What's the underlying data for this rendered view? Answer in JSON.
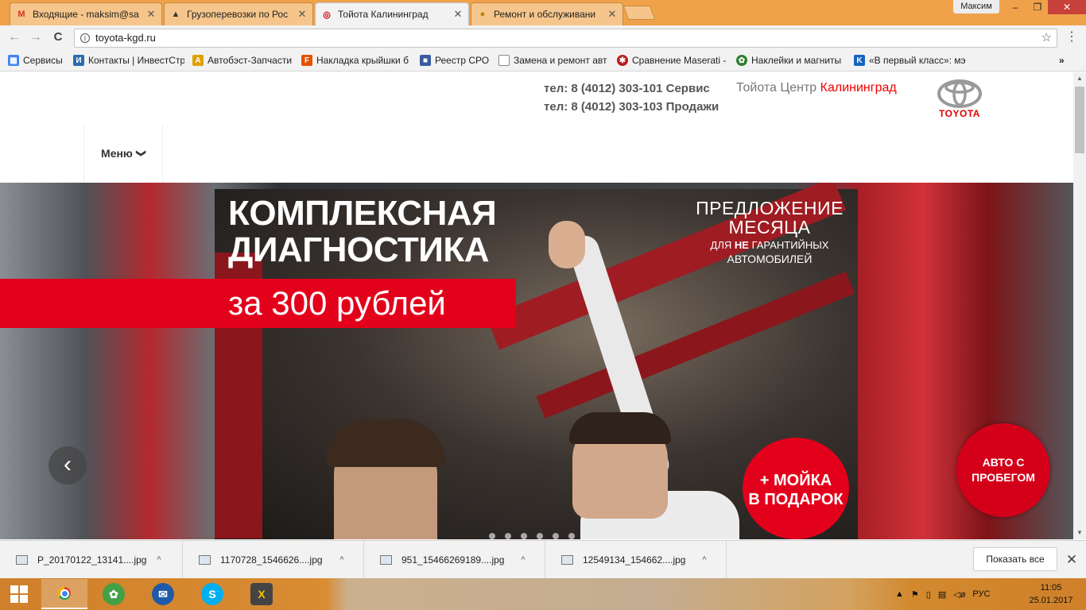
{
  "tabs": [
    {
      "title": "Входящие - maksim@sa",
      "icon": "gmail-icon",
      "active": false
    },
    {
      "title": "Грузоперевозки по Рос",
      "icon": "warning-triangle-icon",
      "active": false
    },
    {
      "title": "Тойота Калининград",
      "icon": "toyota-favicon-icon",
      "active": true
    },
    {
      "title": "Ремонт и обслуживани",
      "icon": "service-favicon-icon",
      "active": false
    }
  ],
  "profile": "Максим",
  "window_controls": {
    "minimize": "–",
    "maximize": "❐",
    "close": "✕"
  },
  "toolbar": {
    "url": "toyota-kgd.ru",
    "back": "←",
    "forward": "→",
    "reload": "C",
    "star": "☆",
    "menu": "⋮"
  },
  "bookmarks": [
    {
      "label": "Сервисы",
      "icon": "apps-grid-icon",
      "color": "#4285f4"
    },
    {
      "label": "Контакты | ИнвестСтр",
      "icon": "invest-icon",
      "color": "#2b6cb0"
    },
    {
      "label": "Автобэст-Запчасти",
      "icon": "autobest-icon",
      "color": "#e0a000"
    },
    {
      "label": "Накладка крыйшки б",
      "icon": "f-letter-icon",
      "color": "#e65100"
    },
    {
      "label": "Реестр СРО",
      "icon": "flag-icon",
      "color": "#3a5ba0"
    },
    {
      "label": "Замена и ремонт авт",
      "icon": "page-icon",
      "color": "#888888"
    },
    {
      "label": "Сравнение Maserati -",
      "icon": "wheel-icon",
      "color": "#b71c1c"
    },
    {
      "label": "Наклейки и магниты",
      "icon": "flower-icon",
      "color": "#2e7d32"
    },
    {
      "label": "«В первый класс»: мэ",
      "icon": "k-letter-icon",
      "color": "#1565c0"
    }
  ],
  "bookmarks_overflow": "»",
  "site": {
    "phone_service": "тел: 8 (4012) 303-101 Сервис",
    "phone_sales": "тел: 8 (4012) 303-103 Продажи",
    "center_label": "Тойота Центр",
    "center_city": "Калининград",
    "logo_text": "TOYOTA",
    "menu_label": "Меню",
    "menu_chevron": "❯"
  },
  "hero": {
    "title_line1": "КОМПЛЕКСНАЯ",
    "title_line2": "ДИАГНОСТИКА",
    "price": "за 300 рублей",
    "offer_line1": "ПРЕДЛОЖЕНИЕ",
    "offer_line2": "МЕСЯЦА",
    "offer_line3_pre": "ДЛЯ",
    "offer_line3_bold": "НЕ",
    "offer_line3_post": "ГАРАНТИЙНЫХ",
    "offer_line4": "АВТОМОБИЛЕЙ",
    "wash_line1": "+ МОЙКА",
    "wash_line2": "В ПОДАРОК",
    "used_line1": "АВТО С",
    "used_line2": "ПРОБЕГОМ",
    "prev_arrow": "‹",
    "slide_count": 6
  },
  "downloads": [
    {
      "name": "P_20170122_13141....jpg"
    },
    {
      "name": "1170728_1546626....jpg"
    },
    {
      "name": "951_15466269189....jpg"
    },
    {
      "name": "12549134_154662....jpg"
    }
  ],
  "downloads_chevron": "^",
  "downloads_show_all": "Показать все",
  "downloads_close": "✕",
  "taskbar": {
    "apps": [
      {
        "name": "chrome",
        "icon": "chrome-icon",
        "color": "#db4437",
        "active": true
      },
      {
        "name": "icq",
        "icon": "icq-flower-icon",
        "color": "#43a047",
        "active": false
      },
      {
        "name": "thunderbird",
        "icon": "thunderbird-icon",
        "color": "#1e5aa8",
        "active": false
      },
      {
        "name": "skype",
        "icon": "skype-icon",
        "color": "#00aff0",
        "active": false
      },
      {
        "name": "xmeeting",
        "icon": "x-app-icon",
        "color": "#444444",
        "active": false
      }
    ],
    "tray_arrow": "▲",
    "language": "РУС",
    "time": "11:05",
    "date": "25.01.2017"
  }
}
